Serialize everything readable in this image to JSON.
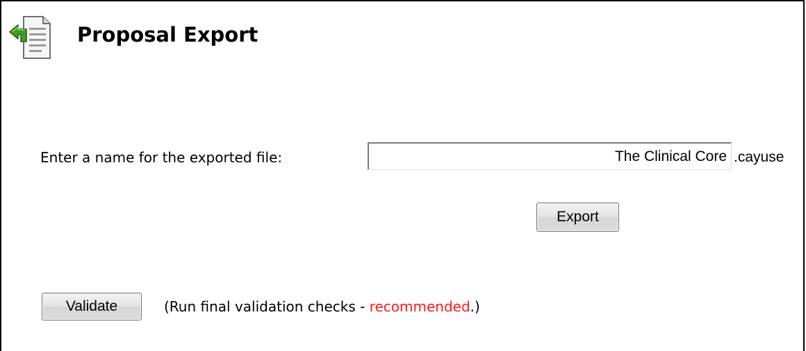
{
  "header": {
    "title": "Proposal Export",
    "icon": "export-document-icon"
  },
  "export_form": {
    "label": "Enter a name for the exported file:",
    "filename_value": "The Clinical Core",
    "extension": ".cayuse",
    "export_label": "Export"
  },
  "validation": {
    "button_label": "Validate",
    "note_prefix": "(Run final validation checks - ",
    "note_highlight": "recommended",
    "note_suffix": ".)",
    "highlight_color": "#ff1a1a"
  }
}
